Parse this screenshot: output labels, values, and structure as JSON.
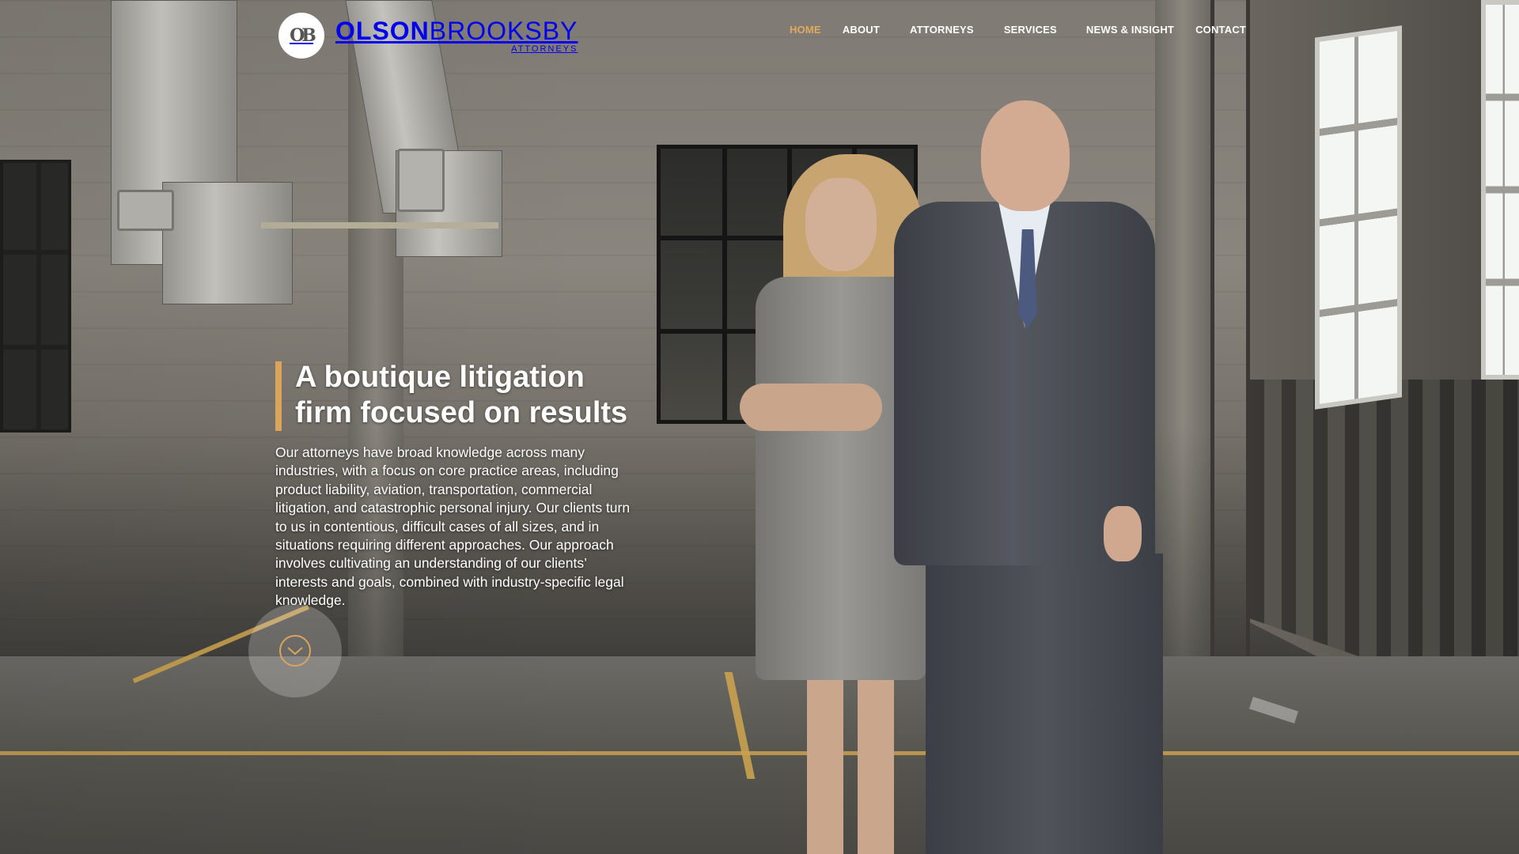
{
  "brand": {
    "monogram": "OB",
    "name_bold": "OLSON",
    "name_light": "BROOKSBY",
    "subtitle": "ATTORNEYS"
  },
  "nav": {
    "items": [
      {
        "label": "HOME",
        "active": true
      },
      {
        "label": "ABOUT",
        "active": false
      },
      {
        "label": "ATTORNEYS",
        "active": false
      },
      {
        "label": "SERVICES",
        "active": false
      },
      {
        "label": "NEWS & INSIGHT",
        "active": false
      },
      {
        "label": "CONTACT",
        "active": false
      }
    ]
  },
  "hero": {
    "title_line1": "A boutique litigation",
    "title_line2": "firm focused on results",
    "body": "Our attorneys have broad knowledge across many industries, with a focus on core practice areas, including product liability, aviation, transportation, commercial litigation, and catastrophic personal injury.  Our clients turn to us in contentious, difficult cases of all sizes, and in situations requiring different approaches.  Our approach involves cultivating an understanding of our clients’ interests and goals, combined with industry-specific legal knowledge.",
    "scroll_icon": "chevron-down-icon"
  },
  "colors": {
    "accent": "#d9a55c",
    "nav_active": "#e0a960",
    "text": "#ffffff"
  }
}
